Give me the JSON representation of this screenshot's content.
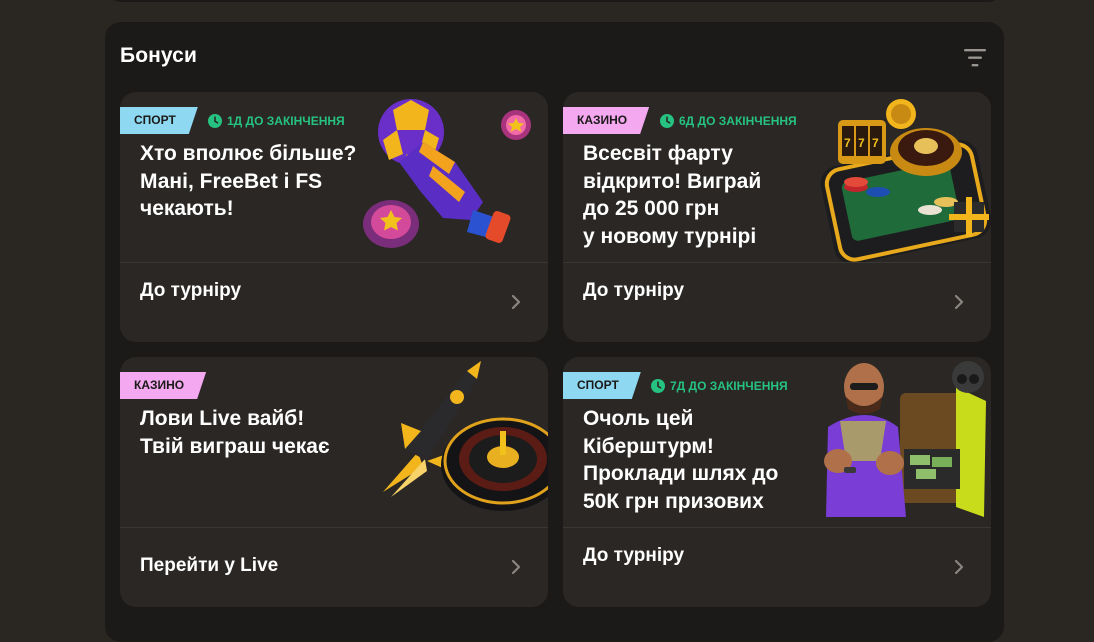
{
  "section": {
    "title": "Бонуси",
    "filter_icon": "filter-icon"
  },
  "colors": {
    "sport_badge": "#8ed8f2",
    "casino_badge": "#f3a8f0",
    "timer": "#26c281",
    "card_bg": "#2a2724",
    "panel_bg": "#1b1a18"
  },
  "cards": [
    {
      "badge": "СПОРТ",
      "timer": "1Д ДО ЗАКІНЧЕННЯ",
      "title": "Хто вполює більше?\nМані, FreeBet і FS\nчекають!",
      "link": "До турніру",
      "illustration": "goalkeeper-glove-ball-illustration"
    },
    {
      "badge": "КАЗИНО",
      "timer": "6Д ДО ЗАКІНЧЕННЯ",
      "title": "Всесвіт фарту\nвідкрито! Виграй\nдо 25 000 грн\nу новому турнірі",
      "link": "До турніру",
      "illustration": "phone-roulette-slots-illustration"
    },
    {
      "badge": "КАЗИНО",
      "title": "Лови Live вайб!\nТвій виграш чекає",
      "link": "Перейти у Live",
      "illustration": "rocket-roulette-illustration"
    },
    {
      "badge": "СПОРТ",
      "timer": "7Д ДО ЗАКІНЧЕННЯ",
      "title": "Очоль цей\nКіберштурм!\nПроклади шлях до\n50К грн призових",
      "link": "До турніру",
      "illustration": "cs-soldiers-money-illustration"
    }
  ]
}
